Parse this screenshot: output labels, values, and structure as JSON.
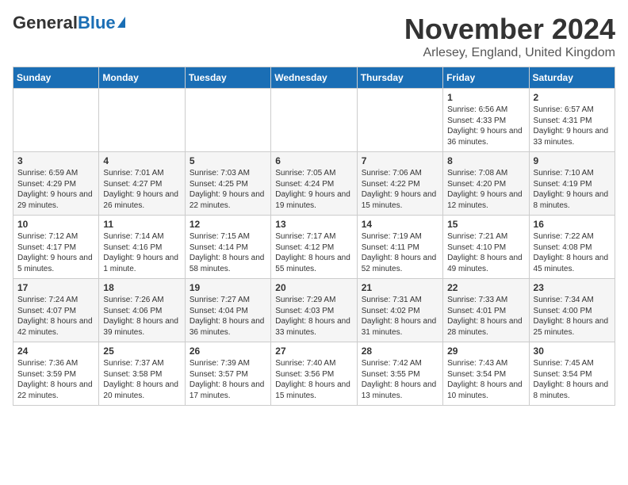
{
  "header": {
    "logo_general": "General",
    "logo_blue": "Blue",
    "month_title": "November 2024",
    "location": "Arlesey, England, United Kingdom"
  },
  "days_of_week": [
    "Sunday",
    "Monday",
    "Tuesday",
    "Wednesday",
    "Thursday",
    "Friday",
    "Saturday"
  ],
  "weeks": [
    [
      {
        "day": "",
        "data": ""
      },
      {
        "day": "",
        "data": ""
      },
      {
        "day": "",
        "data": ""
      },
      {
        "day": "",
        "data": ""
      },
      {
        "day": "",
        "data": ""
      },
      {
        "day": "1",
        "data": "Sunrise: 6:56 AM\nSunset: 4:33 PM\nDaylight: 9 hours and 36 minutes."
      },
      {
        "day": "2",
        "data": "Sunrise: 6:57 AM\nSunset: 4:31 PM\nDaylight: 9 hours and 33 minutes."
      }
    ],
    [
      {
        "day": "3",
        "data": "Sunrise: 6:59 AM\nSunset: 4:29 PM\nDaylight: 9 hours and 29 minutes."
      },
      {
        "day": "4",
        "data": "Sunrise: 7:01 AM\nSunset: 4:27 PM\nDaylight: 9 hours and 26 minutes."
      },
      {
        "day": "5",
        "data": "Sunrise: 7:03 AM\nSunset: 4:25 PM\nDaylight: 9 hours and 22 minutes."
      },
      {
        "day": "6",
        "data": "Sunrise: 7:05 AM\nSunset: 4:24 PM\nDaylight: 9 hours and 19 minutes."
      },
      {
        "day": "7",
        "data": "Sunrise: 7:06 AM\nSunset: 4:22 PM\nDaylight: 9 hours and 15 minutes."
      },
      {
        "day": "8",
        "data": "Sunrise: 7:08 AM\nSunset: 4:20 PM\nDaylight: 9 hours and 12 minutes."
      },
      {
        "day": "9",
        "data": "Sunrise: 7:10 AM\nSunset: 4:19 PM\nDaylight: 9 hours and 8 minutes."
      }
    ],
    [
      {
        "day": "10",
        "data": "Sunrise: 7:12 AM\nSunset: 4:17 PM\nDaylight: 9 hours and 5 minutes."
      },
      {
        "day": "11",
        "data": "Sunrise: 7:14 AM\nSunset: 4:16 PM\nDaylight: 9 hours and 1 minute."
      },
      {
        "day": "12",
        "data": "Sunrise: 7:15 AM\nSunset: 4:14 PM\nDaylight: 8 hours and 58 minutes."
      },
      {
        "day": "13",
        "data": "Sunrise: 7:17 AM\nSunset: 4:12 PM\nDaylight: 8 hours and 55 minutes."
      },
      {
        "day": "14",
        "data": "Sunrise: 7:19 AM\nSunset: 4:11 PM\nDaylight: 8 hours and 52 minutes."
      },
      {
        "day": "15",
        "data": "Sunrise: 7:21 AM\nSunset: 4:10 PM\nDaylight: 8 hours and 49 minutes."
      },
      {
        "day": "16",
        "data": "Sunrise: 7:22 AM\nSunset: 4:08 PM\nDaylight: 8 hours and 45 minutes."
      }
    ],
    [
      {
        "day": "17",
        "data": "Sunrise: 7:24 AM\nSunset: 4:07 PM\nDaylight: 8 hours and 42 minutes."
      },
      {
        "day": "18",
        "data": "Sunrise: 7:26 AM\nSunset: 4:06 PM\nDaylight: 8 hours and 39 minutes."
      },
      {
        "day": "19",
        "data": "Sunrise: 7:27 AM\nSunset: 4:04 PM\nDaylight: 8 hours and 36 minutes."
      },
      {
        "day": "20",
        "data": "Sunrise: 7:29 AM\nSunset: 4:03 PM\nDaylight: 8 hours and 33 minutes."
      },
      {
        "day": "21",
        "data": "Sunrise: 7:31 AM\nSunset: 4:02 PM\nDaylight: 8 hours and 31 minutes."
      },
      {
        "day": "22",
        "data": "Sunrise: 7:33 AM\nSunset: 4:01 PM\nDaylight: 8 hours and 28 minutes."
      },
      {
        "day": "23",
        "data": "Sunrise: 7:34 AM\nSunset: 4:00 PM\nDaylight: 8 hours and 25 minutes."
      }
    ],
    [
      {
        "day": "24",
        "data": "Sunrise: 7:36 AM\nSunset: 3:59 PM\nDaylight: 8 hours and 22 minutes."
      },
      {
        "day": "25",
        "data": "Sunrise: 7:37 AM\nSunset: 3:58 PM\nDaylight: 8 hours and 20 minutes."
      },
      {
        "day": "26",
        "data": "Sunrise: 7:39 AM\nSunset: 3:57 PM\nDaylight: 8 hours and 17 minutes."
      },
      {
        "day": "27",
        "data": "Sunrise: 7:40 AM\nSunset: 3:56 PM\nDaylight: 8 hours and 15 minutes."
      },
      {
        "day": "28",
        "data": "Sunrise: 7:42 AM\nSunset: 3:55 PM\nDaylight: 8 hours and 13 minutes."
      },
      {
        "day": "29",
        "data": "Sunrise: 7:43 AM\nSunset: 3:54 PM\nDaylight: 8 hours and 10 minutes."
      },
      {
        "day": "30",
        "data": "Sunrise: 7:45 AM\nSunset: 3:54 PM\nDaylight: 8 hours and 8 minutes."
      }
    ]
  ]
}
